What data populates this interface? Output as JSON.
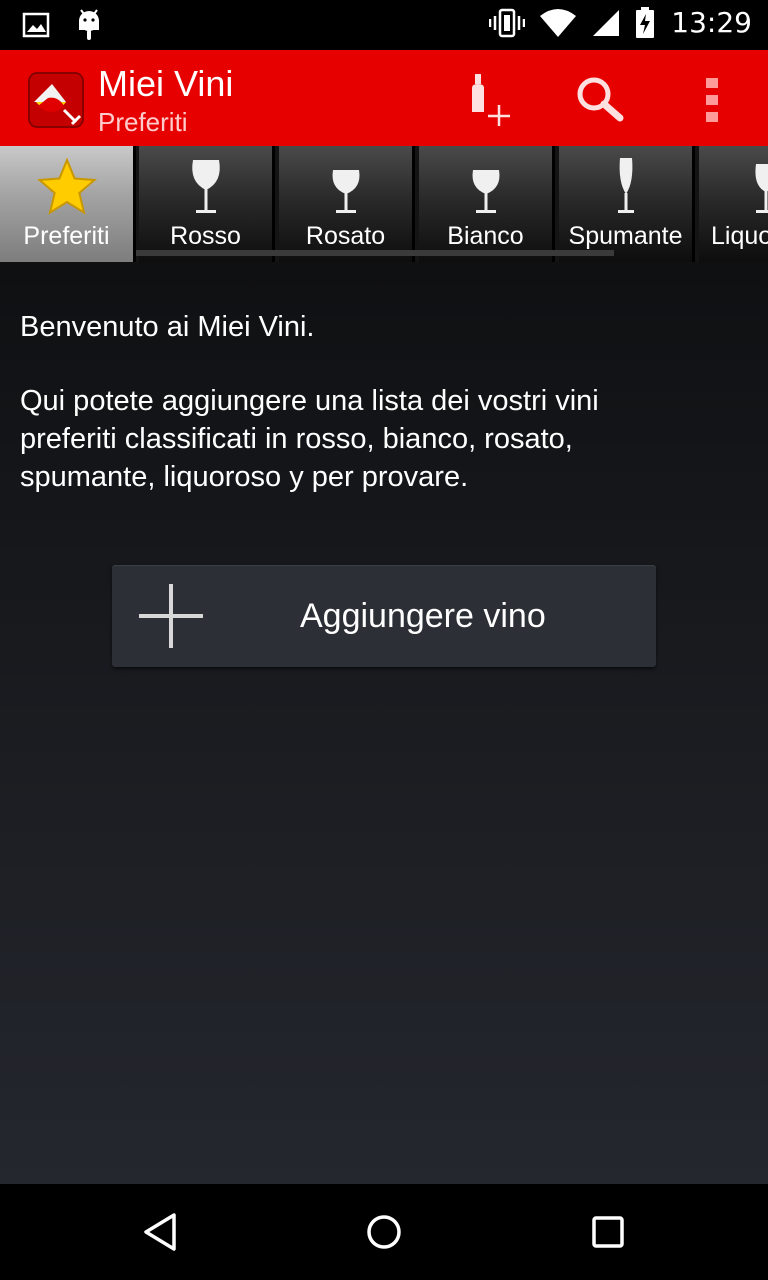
{
  "status_bar": {
    "time": "13:29",
    "left_icons": [
      "image-notification-icon",
      "android-notification-icon"
    ],
    "right_icons": [
      "vibrate-icon",
      "wifi-icon",
      "cell-signal-icon",
      "battery-charging-icon"
    ]
  },
  "app_bar": {
    "title": "Miei Vini",
    "subtitle": "Preferiti",
    "background_color": "#e60000",
    "actions": [
      "add-bottle-icon",
      "search-icon",
      "overflow-menu-icon"
    ]
  },
  "tabs": [
    {
      "label": "Preferiti",
      "icon": "star-icon",
      "selected": true
    },
    {
      "label": "Rosso",
      "icon": "wine-glass-icon",
      "selected": false
    },
    {
      "label": "Rosato",
      "icon": "wine-glass-icon",
      "selected": false
    },
    {
      "label": "Bianco",
      "icon": "wine-glass-icon",
      "selected": false
    },
    {
      "label": "Spumante",
      "icon": "flute-glass-icon",
      "selected": false
    },
    {
      "label": "Liquoroso",
      "icon": "wine-glass-icon",
      "selected": false
    }
  ],
  "content": {
    "welcome": "Benvenuto ai Miei Vini.",
    "description": "Qui potete aggiungere una lista dei vostri vini preferiti classificati in rosso, bianco, rosato, spumante, liquoroso y per provare.",
    "add_button_label": "Aggiungere vino"
  },
  "nav_bar": {
    "buttons": [
      "back-icon",
      "home-icon",
      "recents-icon"
    ]
  }
}
